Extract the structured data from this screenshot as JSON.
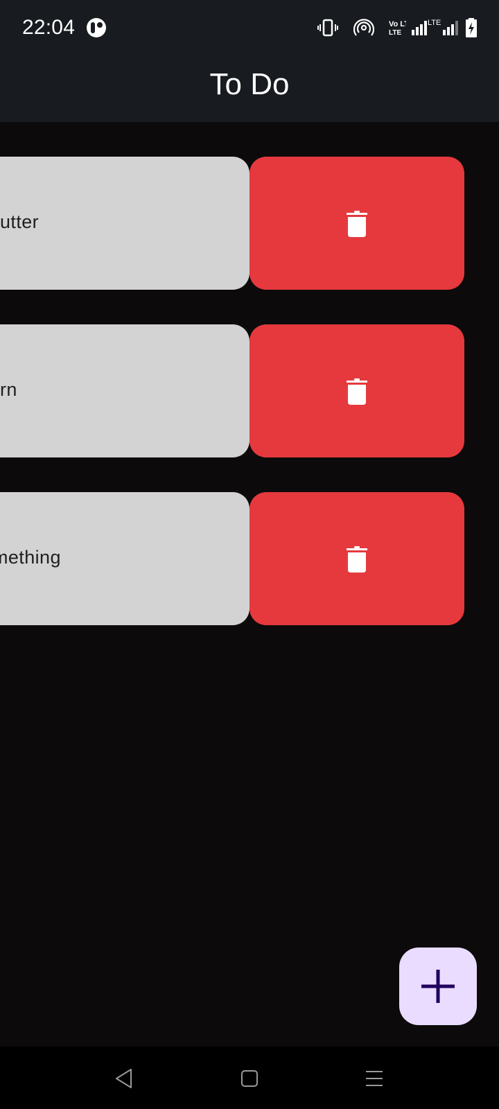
{
  "status_bar": {
    "time": "22:04",
    "icons": [
      "app-notification-icon",
      "vibrate-icon",
      "hotspot-icon",
      "volte-icon",
      "signal-icon",
      "lte-signal-icon",
      "battery-charging-icon"
    ],
    "volte_label": "Vo LTE",
    "lte_label": "LTE"
  },
  "app_bar": {
    "title": "To Do"
  },
  "todos": [
    {
      "text": "utter",
      "action": "delete"
    },
    {
      "text": "rn",
      "action": "delete"
    },
    {
      "text": "mething",
      "action": "delete"
    }
  ],
  "fab": {
    "icon": "plus-icon"
  },
  "nav_bar": {
    "buttons": [
      "back-icon",
      "home-icon",
      "recents-icon"
    ]
  },
  "colors": {
    "background": "#0c0a0b",
    "app_bar": "#181b1f",
    "card": "#d3d3d3",
    "delete": "#e5393d",
    "fab": "#eadcff",
    "fab_icon": "#21005d"
  }
}
